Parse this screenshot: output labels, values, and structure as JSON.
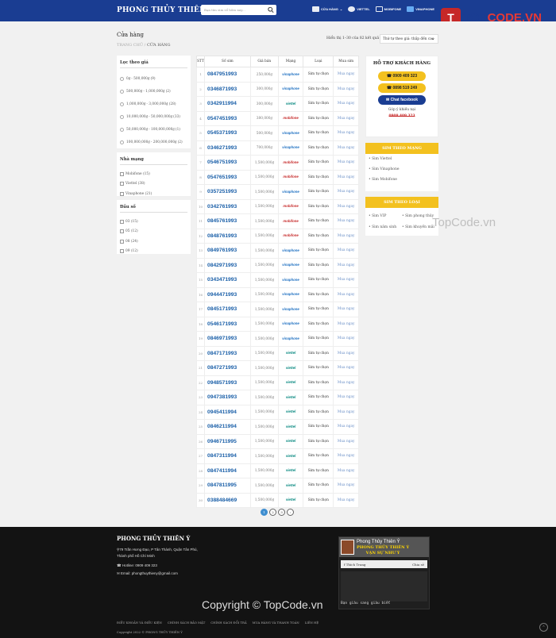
{
  "header": {
    "brand": "PHONG THỦY THIÊN Ý",
    "search_placeholder": "Bạn tìm sim sổ hôm nay...",
    "nav": [
      {
        "label": "CỬA HÀNG",
        "icon": "store-icon"
      },
      {
        "label": "VIETTEL",
        "icon": "viettel-logo-icon"
      },
      {
        "label": "MOBIFONE",
        "icon": "mobifone-logo-icon"
      },
      {
        "label": "VINAPHONE",
        "icon": "vinaphone-logo-icon"
      }
    ]
  },
  "watermark": {
    "badge": "T",
    "name_pre": "TOP",
    "name_post": "CODE.VN",
    "center": "TopCode.vn"
  },
  "page": {
    "title": "Cửa hàng",
    "breadcrumb_home": "TRANG CHỦ",
    "breadcrumb_sep": "/",
    "breadcrumb_current": "CỬA HÀNG",
    "result_text": "Hiển thị 1–30 của 82 kết quả",
    "sort_selected": "Thứ tự theo giá: thấp đến cao"
  },
  "filters": {
    "price": {
      "title": "Lọc theo giá",
      "options": [
        "0₫ - 500,000₫ (9)",
        "500,000₫ - 1,000,000₫ (2)",
        "1,000,000₫ - 3,000,000₫ (28)",
        "10,000,000₫ - 50,000,000₫ (33)",
        "50,000,000₫ - 100,000,000₫ (1)",
        "100,000,000₫ - 200,000,000₫ (2)"
      ]
    },
    "network": {
      "title": "Nhà mạng",
      "options": [
        "Mobifone (15)",
        "Viettel (38)",
        "Vinaphone (21)"
      ]
    },
    "prefix": {
      "title": "Đầu số",
      "options": [
        "03 (15)",
        "05 (12)",
        "08 (24)",
        "09 (12)"
      ]
    }
  },
  "table": {
    "headers": [
      "STT",
      "Số sim",
      "Giá bán",
      "Mạng",
      "Loại",
      "Mua sim"
    ],
    "rows": [
      {
        "stt": "1",
        "number": "0847951993",
        "price": "250,000₫",
        "network": "vinaphone",
        "type": "Sim tự chọn",
        "buy": "Mua ngay"
      },
      {
        "stt": "2",
        "number": "0346871993",
        "price": "300,000₫",
        "network": "vinaphone",
        "type": "Sim tự chọn",
        "buy": "Mua ngay"
      },
      {
        "stt": "3",
        "number": "0342911994",
        "price": "300,000₫",
        "network": "viettel",
        "type": "Sim tự chọn",
        "buy": "Mua ngay"
      },
      {
        "stt": "4",
        "number": "0547451993",
        "price": "380,000₫",
        "network": "mobifone",
        "type": "Sim tự chọn",
        "buy": "Mua ngay"
      },
      {
        "stt": "5",
        "number": "0545371993",
        "price": "500,000₫",
        "network": "vinaphone",
        "type": "Sim tự chọn",
        "buy": "Mua ngay"
      },
      {
        "stt": "6",
        "number": "0346271993",
        "price": "700,000₫",
        "network": "vinaphone",
        "type": "Sim tự chọn",
        "buy": "Mua ngay"
      },
      {
        "stt": "7",
        "number": "0546751993",
        "price": "1,500,000₫",
        "network": "mobifone",
        "type": "Sim tự chọn",
        "buy": "Mua ngay"
      },
      {
        "stt": "8",
        "number": "0547651993",
        "price": "1,500,000₫",
        "network": "mobifone",
        "type": "Sim tự chọn",
        "buy": "Mua ngay"
      },
      {
        "stt": "9",
        "number": "0357251993",
        "price": "1,500,000₫",
        "network": "vinaphone",
        "type": "Sim tự chọn",
        "buy": "Mua ngay"
      },
      {
        "stt": "10",
        "number": "0342761993",
        "price": "1,500,000₫",
        "network": "mobifone",
        "type": "Sim tự chọn",
        "buy": "Mua ngay"
      },
      {
        "stt": "11",
        "number": "0845761993",
        "price": "1,500,000₫",
        "network": "mobifone",
        "type": "Sim tự chọn",
        "buy": "Mua ngay"
      },
      {
        "stt": "12",
        "number": "0848761993",
        "price": "1,500,000₫",
        "network": "mobifone",
        "type": "Sim tự chọn",
        "buy": "Mua ngay"
      },
      {
        "stt": "13",
        "number": "0849761993",
        "price": "1,500,000₫",
        "network": "vinaphone",
        "type": "Sim tự chọn",
        "buy": "Mua ngay"
      },
      {
        "stt": "14",
        "number": "0842971993",
        "price": "1,500,000₫",
        "network": "vinaphone",
        "type": "Sim tự chọn",
        "buy": "Mua ngay"
      },
      {
        "stt": "15",
        "number": "0343471993",
        "price": "1,500,000₫",
        "network": "vinaphone",
        "type": "Sim tự chọn",
        "buy": "Mua ngay"
      },
      {
        "stt": "16",
        "number": "0944471993",
        "price": "1,500,000₫",
        "network": "vinaphone",
        "type": "Sim tự chọn",
        "buy": "Mua ngay"
      },
      {
        "stt": "17",
        "number": "0845171993",
        "price": "1,500,000₫",
        "network": "vinaphone",
        "type": "Sim tự chọn",
        "buy": "Mua ngay"
      },
      {
        "stt": "18",
        "number": "0546171993",
        "price": "1,500,000₫",
        "network": "vinaphone",
        "type": "Sim tự chọn",
        "buy": "Mua ngay"
      },
      {
        "stt": "19",
        "number": "0846971993",
        "price": "1,500,000₫",
        "network": "vinaphone",
        "type": "Sim tự chọn",
        "buy": "Mua ngay"
      },
      {
        "stt": "20",
        "number": "0847171993",
        "price": "1,500,000₫",
        "network": "viettel",
        "type": "Sim tự chọn",
        "buy": "Mua ngay"
      },
      {
        "stt": "21",
        "number": "0847271993",
        "price": "1,500,000₫",
        "network": "viettel",
        "type": "Sim tự chọn",
        "buy": "Mua ngay"
      },
      {
        "stt": "22",
        "number": "0948571993",
        "price": "1,500,000₫",
        "network": "viettel",
        "type": "Sim tự chọn",
        "buy": "Mua ngay"
      },
      {
        "stt": "23",
        "number": "0947381993",
        "price": "1,500,000₫",
        "network": "viettel",
        "type": "Sim tự chọn",
        "buy": "Mua ngay"
      },
      {
        "stt": "24",
        "number": "0945411994",
        "price": "1,500,000₫",
        "network": "viettel",
        "type": "Sim tự chọn",
        "buy": "Mua ngay"
      },
      {
        "stt": "25",
        "number": "0846211994",
        "price": "1,500,000₫",
        "network": "viettel",
        "type": "Sim tự chọn",
        "buy": "Mua ngay"
      },
      {
        "stt": "26",
        "number": "0946711995",
        "price": "1,500,000₫",
        "network": "viettel",
        "type": "Sim tự chọn",
        "buy": "Mua ngay"
      },
      {
        "stt": "27",
        "number": "0847311994",
        "price": "1,500,000₫",
        "network": "viettel",
        "type": "Sim tự chọn",
        "buy": "Mua ngay"
      },
      {
        "stt": "28",
        "number": "0847411994",
        "price": "1,500,000₫",
        "network": "viettel",
        "type": "Sim tự chọn",
        "buy": "Mua ngay"
      },
      {
        "stt": "29",
        "number": "0847811995",
        "price": "1,500,000₫",
        "network": "viettel",
        "type": "Sim tự chọn",
        "buy": "Mua ngay"
      },
      {
        "stt": "30",
        "number": "0388484669",
        "price": "1,500,000₫",
        "network": "viettel",
        "type": "Sim tự chọn",
        "buy": "Mua ngay"
      }
    ],
    "network_labels": {
      "viettel": "viettel",
      "vinaphone": "vinaphone",
      "mobifone": "mobifone"
    }
  },
  "pagination": {
    "pages": [
      "1",
      "2",
      "3",
      "›"
    ],
    "current": "1"
  },
  "support": {
    "title": "HỖ TRỢ KHÁCH HÀNG",
    "phone1": "0909 409 323",
    "phone2": "0898 519 249",
    "facebook": "Chat facebook",
    "caption": "Góp ý khiếu nại",
    "caption_phone": "0909 409 323"
  },
  "sim_by_network": {
    "title": "SIM THEO MẠNG",
    "items": [
      "Sim Viettel",
      "Sim Vinaphone",
      "Sim Mobifone"
    ]
  },
  "sim_by_type": {
    "title": "SIM THEO LOẠI",
    "items": [
      "Sim VIP",
      "Sim phong thủy",
      "Sim năm sinh",
      "Sim khuyến mãi"
    ]
  },
  "footer": {
    "brand": "PHONG THỦY THIÊN Ý",
    "address_line1": "79 Trần Hưng Đạo, P Tân Thành, Quận Tân Phú,",
    "address_line2": "Thành phố Hồ Chí Minh",
    "hotline": "Hotline: 0909 409 323",
    "email": "Email: phongthuythieny@gmail.com",
    "fb_name": "Phong Thủy Thiên Ý",
    "fb_slogan_1": "PHONG THỦY THIÊN Ý",
    "fb_slogan_2": "VẠN SỰ NHƯ Ý",
    "fb_like": "Thích Trang",
    "fb_share": "Chia sẻ",
    "fb_caption": "Bạn giàu sang giàu biết",
    "copyright_big": "Copyright © TopCode.vn",
    "links": [
      "ĐIỀU KHOẢN VÀ ĐIỀU KIỆN",
      "CHÍNH SÁCH BẢO MẬT",
      "CHÍNH SÁCH ĐỔI TRẢ",
      "MUA HÀNG VÀ THANH TOÁN",
      "LIÊN HỆ"
    ],
    "copyright": "Copyright 2022 © PHONG THỦY THIÊN Ý"
  }
}
